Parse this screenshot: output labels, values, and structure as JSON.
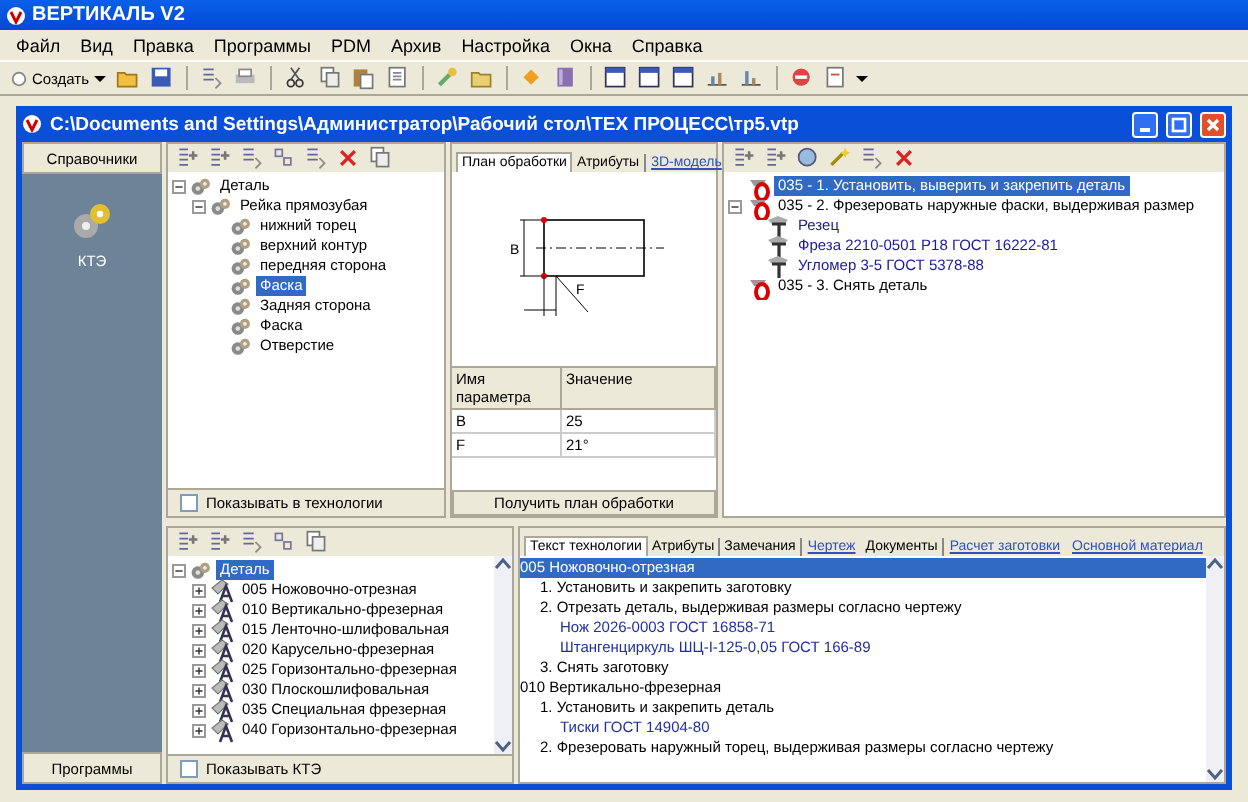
{
  "app": {
    "title": "ВЕРТИКАЛЬ V2"
  },
  "menu": [
    "Файл",
    "Вид",
    "Правка",
    "Программы",
    "PDM",
    "Архив",
    "Настройка",
    "Окна",
    "Справка"
  ],
  "toolbar": {
    "create_label": "Создать"
  },
  "document_window": {
    "title": "C:\\Documents and Settings\\Администратор\\Рабочий стол\\ТЕХ ПРОЦЕСС\\тр5.vtp"
  },
  "sidebar": {
    "header": "Справочники",
    "items": [
      {
        "label": "КТЭ"
      }
    ],
    "footer": "Программы"
  },
  "element_tree": {
    "nodes": [
      {
        "label": "Деталь",
        "expanded": true,
        "selected": false,
        "children": [
          {
            "label": "Рейка прямозубая",
            "expanded": true,
            "selected": false,
            "children": [
              {
                "label": "нижний торец",
                "selected": false
              },
              {
                "label": "верхний контур",
                "selected": false
              },
              {
                "label": "передняя сторона",
                "selected": false
              },
              {
                "label": "Фаска",
                "selected": true
              },
              {
                "label": "Задняя сторона",
                "selected": false
              },
              {
                "label": "Фаска",
                "selected": false
              },
              {
                "label": "Отверстие",
                "selected": false
              }
            ]
          }
        ]
      }
    ],
    "checkbox": {
      "label": "Показывать в технологии",
      "checked": false
    }
  },
  "plan_panel": {
    "tabs": [
      {
        "label": "План обработки",
        "kind": "tab",
        "selected": true
      },
      {
        "label": "Атрибуты",
        "kind": "tab",
        "selected": false
      },
      {
        "label": "3D-модель",
        "kind": "link",
        "selected": false
      }
    ],
    "drawing_labels": [
      "B",
      "F"
    ],
    "params": {
      "columns": [
        "Имя параметра",
        "Значение"
      ],
      "rows": [
        [
          "B",
          "25"
        ],
        [
          "F",
          "21°"
        ]
      ]
    },
    "button": "Получить план обработки"
  },
  "operation_tree": {
    "nodes": [
      {
        "label": "035 - 1. Установить, выверить и закрепить деталь",
        "kind": "step",
        "selected": true
      },
      {
        "label": "035 - 2. Фрезеровать наружные фаски, выдерживая размер",
        "kind": "step",
        "expanded": true,
        "selected": false,
        "children": [
          {
            "label": "Резец",
            "kind": "tool",
            "selected": false
          },
          {
            "label": "Фреза 2210-0501 Р18 ГОСТ 16222-81",
            "kind": "tool",
            "selected": false
          },
          {
            "label": "Угломер 3-5 ГОСТ 5378-88",
            "kind": "tool",
            "selected": false
          }
        ]
      },
      {
        "label": "035 - 3. Снять деталь",
        "kind": "step",
        "selected": false
      }
    ]
  },
  "process_tree": {
    "nodes": [
      {
        "label": "Деталь",
        "expanded": true,
        "selected": true,
        "children": [
          {
            "label": "005 Ножовочно-отрезная",
            "expanded": false,
            "selected": false
          },
          {
            "label": "010 Вертикально-фрезерная",
            "expanded": false,
            "selected": false
          },
          {
            "label": "015 Ленточно-шлифовальная",
            "expanded": false,
            "selected": false
          },
          {
            "label": "020 Карусельно-фрезерная",
            "expanded": false,
            "selected": false
          },
          {
            "label": "025 Горизонтально-фрезерная",
            "expanded": false,
            "selected": false
          },
          {
            "label": "030 Плоскошлифовальная",
            "expanded": false,
            "selected": false
          },
          {
            "label": "035 Специальная фрезерная",
            "expanded": false,
            "selected": false
          },
          {
            "label": "040 Горизонтально-фрезерная",
            "expanded": false,
            "selected": false
          }
        ]
      }
    ],
    "checkbox": {
      "label": "Показывать КТЭ",
      "checked": false
    }
  },
  "process_text": {
    "tabs": [
      {
        "label": "Текст технологии",
        "kind": "tab",
        "selected": true
      },
      {
        "label": "Атрибуты",
        "kind": "tab",
        "selected": false
      },
      {
        "label": "Замечания",
        "kind": "tab",
        "selected": false
      },
      {
        "label": "Чертеж",
        "kind": "link",
        "selected": false
      },
      {
        "label": "Документы",
        "kind": "tab",
        "selected": false
      },
      {
        "label": "Расчет заготовки",
        "kind": "link",
        "selected": false
      },
      {
        "label": "Основной материал",
        "kind": "link",
        "selected": false
      }
    ],
    "lines": [
      {
        "text": "005 Ножовочно-отрезная",
        "kind": "operation",
        "selected": true
      },
      {
        "text": "1. Установить и закрепить заготовку",
        "kind": "step",
        "selected": false
      },
      {
        "text": "2. Отрезать деталь, выдерживая размеры согласно чертежу",
        "kind": "step",
        "selected": false
      },
      {
        "text": "Нож 2026-0003   ГОСТ 16858-71",
        "kind": "tooling",
        "selected": false
      },
      {
        "text": "Штангенциркуль ШЦ-I-125-0,05 ГОСТ 166-89",
        "kind": "tooling",
        "selected": false
      },
      {
        "text": "3. Снять заготовку",
        "kind": "step",
        "selected": false
      },
      {
        "text": "010 Вертикально-фрезерная",
        "kind": "operation",
        "selected": false
      },
      {
        "text": "1. Установить и закрепить деталь",
        "kind": "step",
        "selected": false
      },
      {
        "text": "Тиски   ГОСТ 14904-80",
        "kind": "tooling",
        "selected": false
      },
      {
        "text": "2. Фрезеровать наружный торец, выдерживая размеры согласно чертежу",
        "kind": "step",
        "selected": false
      }
    ]
  }
}
